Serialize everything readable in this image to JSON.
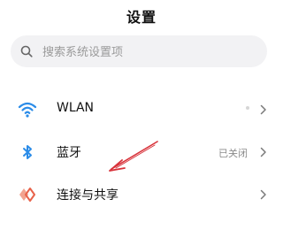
{
  "header": {
    "title": "设置"
  },
  "search": {
    "placeholder": "搜索系统设置项",
    "icon": "search-icon"
  },
  "settings": {
    "items": [
      {
        "label": "WLAN",
        "status": "",
        "icon": "wifi-icon",
        "icon_color": "#2b8ce8"
      },
      {
        "label": "蓝牙",
        "status": "已关闭",
        "icon": "bluetooth-icon",
        "icon_color": "#2b8ce8"
      },
      {
        "label": "连接与共享",
        "status": "",
        "icon": "connection-share-icon",
        "icon_color": "#e8624a"
      }
    ]
  },
  "annotation": {
    "color": "#d8323a",
    "icon": "red-arrow-pointing-bluetooth"
  }
}
